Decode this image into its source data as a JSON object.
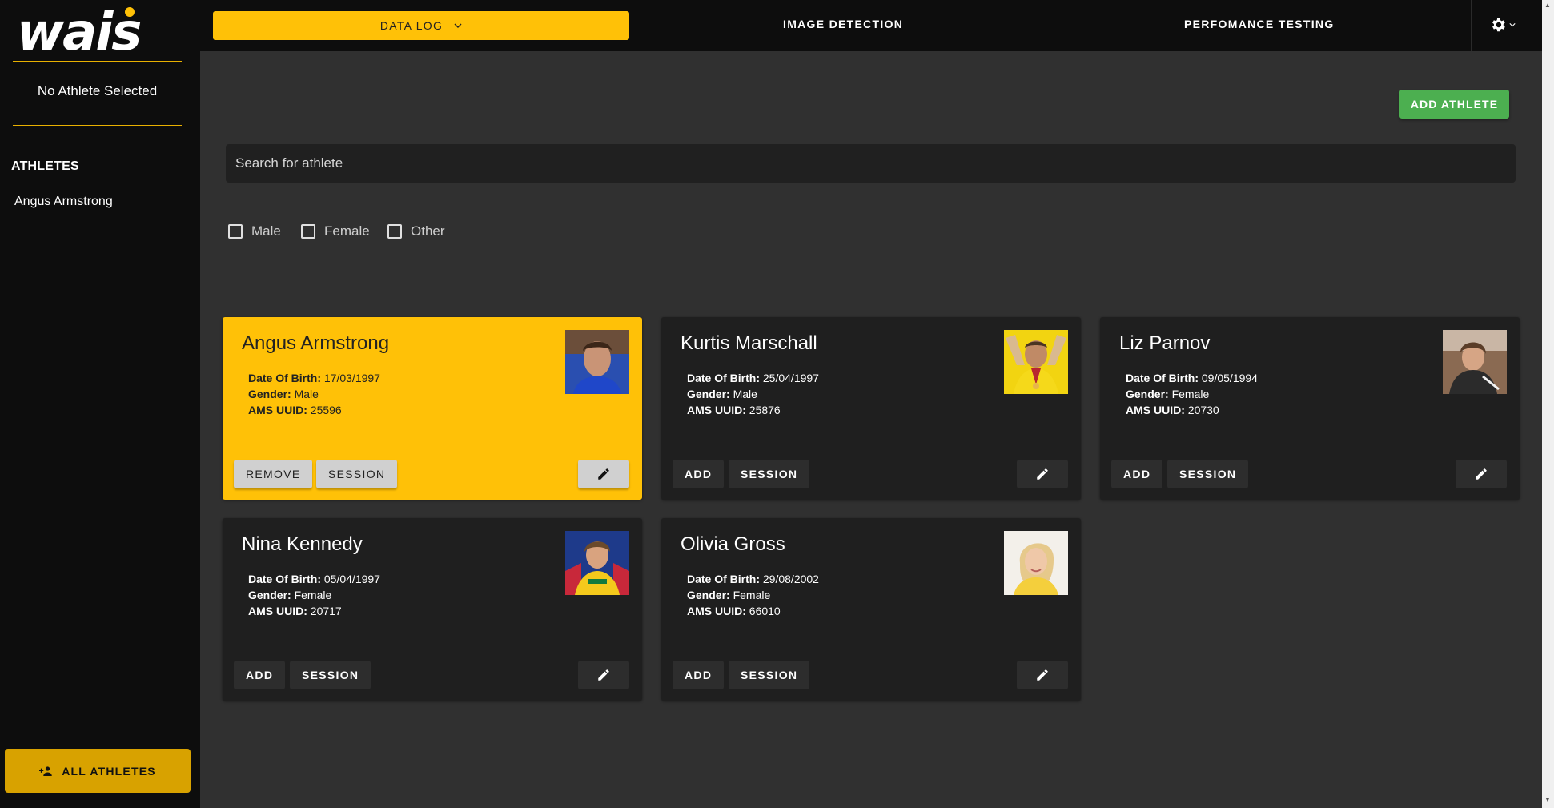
{
  "sidebar": {
    "logo_text": "wais",
    "status": "No Athlete Selected",
    "heading": "ATHLETES",
    "athletes": [
      "Angus Armstrong"
    ],
    "all_button": "ALL ATHLETES"
  },
  "nav": {
    "data_log": "DATA LOG",
    "image_detection": "IMAGE DETECTION",
    "performance_testing": "PERFOMANCE TESTING"
  },
  "main": {
    "add_button": "ADD ATHLETE",
    "search_placeholder": "Search for athlete",
    "filters": [
      "Male",
      "Female",
      "Other"
    ]
  },
  "labels": {
    "dob": "Date Of Birth:",
    "gender": "Gender:",
    "ams": "AMS UUID:",
    "add": "ADD",
    "remove": "REMOVE",
    "session": "SESSION"
  },
  "athletes": [
    {
      "name": "Angus Armstrong",
      "dob": "17/03/1997",
      "gender": "Male",
      "ams": "25596",
      "selected": true
    },
    {
      "name": "Kurtis Marschall",
      "dob": "25/04/1997",
      "gender": "Male",
      "ams": "25876",
      "selected": false
    },
    {
      "name": "Liz Parnov",
      "dob": "09/05/1994",
      "gender": "Female",
      "ams": "20730",
      "selected": false
    },
    {
      "name": "Nina Kennedy",
      "dob": "05/04/1997",
      "gender": "Female",
      "ams": "20717",
      "selected": false
    },
    {
      "name": "Olivia Gross",
      "dob": "29/08/2002",
      "gender": "Female",
      "ams": "66010",
      "selected": false
    }
  ],
  "colors": {
    "accent": "#ffc107",
    "add_athlete": "#4caf50",
    "background": "#303030",
    "sidebar": "#0d0d0d",
    "card": "#1f1f1f"
  }
}
